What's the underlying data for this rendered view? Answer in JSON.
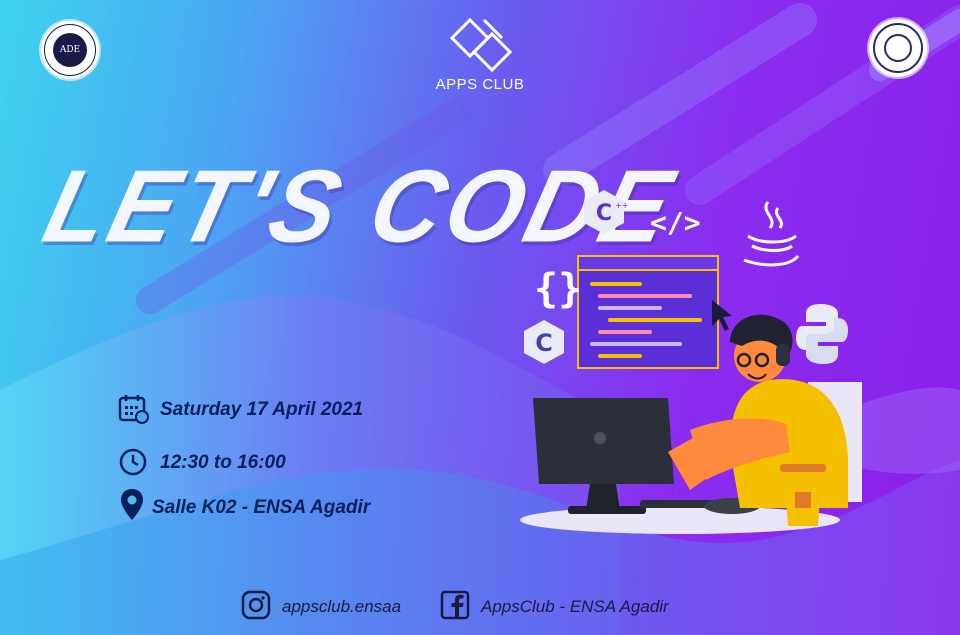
{
  "logos": {
    "left_badge": {
      "text": "ADE",
      "icon": "association-badge-icon"
    },
    "center": {
      "name": "APPS CLUB",
      "icon": "apps-club-logo-icon"
    },
    "right_badge": {
      "icon": "university-seal-icon"
    }
  },
  "title": "LET'S CODE",
  "event": {
    "date": "Saturday 17 April 2021",
    "time": "12:30 to 16:00",
    "location": "Salle K02 - ENSA Agadir"
  },
  "social": {
    "instagram": "appsclub.ensaa",
    "facebook": "AppsClub - ENSA Agadir"
  },
  "tech_icons": [
    "cpp-icon",
    "code-tag-icon",
    "java-icon",
    "braces-icon",
    "c-icon",
    "python-icon"
  ],
  "colors": {
    "title": "#f3f6ff",
    "info_text": "#0b1f5a",
    "accent_yellow": "#f5c000"
  }
}
